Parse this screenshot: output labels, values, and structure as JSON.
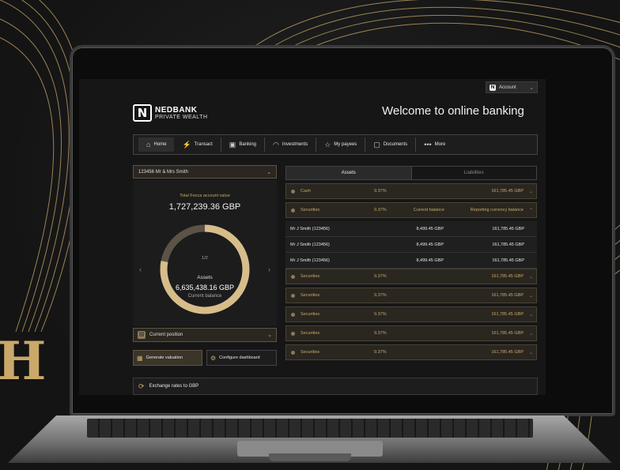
{
  "account_menu": {
    "label": "Account"
  },
  "brand": {
    "name_top": "NEDBANK",
    "name_bottom": "PRIVATE WEALTH"
  },
  "welcome": "Welcome to online banking",
  "nav": [
    {
      "label": "Home",
      "icon": "home-icon",
      "glyph": "⌂"
    },
    {
      "label": "Transact",
      "icon": "transact-icon",
      "glyph": "⚡"
    },
    {
      "label": "Banking",
      "icon": "briefcase-icon",
      "glyph": "▣"
    },
    {
      "label": "Investments",
      "icon": "gauge-icon",
      "glyph": "◠"
    },
    {
      "label": "My payees",
      "icon": "star-icon",
      "glyph": "☆"
    },
    {
      "label": "Documents",
      "icon": "documents-icon",
      "glyph": "▢"
    },
    {
      "label": "More",
      "icon": "more-icon",
      "glyph": "•••"
    }
  ],
  "account_select": {
    "value": "123456   Mr & Mrs Smith"
  },
  "summary": {
    "total_label": "Total Fecca account value",
    "total_value": "1,727,239.36 GBP",
    "page": "1/2",
    "ring_label": "Assets",
    "ring_value": "6,635,438.16 GBP",
    "ring_sublabel": "Current balance",
    "ring_fraction": 0.78
  },
  "current_position": "Current position",
  "buttons": {
    "generate": "Generate valuation",
    "configure": "Configure dashboard"
  },
  "tabs": [
    "Assets",
    "Liabilities"
  ],
  "rows": [
    {
      "kind": "cat",
      "name": "Cash",
      "pct": "9.37%",
      "mid": "",
      "val": "161,785.45 GBP",
      "chev": "⌄"
    },
    {
      "kind": "cat",
      "name": "Securities",
      "pct": "9.37%",
      "mid": "Current balance",
      "val": "Reporting currency balance",
      "chev": "⌃"
    },
    {
      "kind": "sub",
      "name": "Mr J Smith (123456)",
      "pct": "",
      "mid": "8,499.45 GBP",
      "val": "161,785.45 GBP",
      "chev": ""
    },
    {
      "kind": "sub",
      "name": "Mr J Smith (123456)",
      "pct": "",
      "mid": "8,499.45 GBP",
      "val": "161,785.45 GBP",
      "chev": ""
    },
    {
      "kind": "sub",
      "name": "Mr J Smith (123456)",
      "pct": "",
      "mid": "8,499.45 GBP",
      "val": "161,785.45 GBP",
      "chev": ""
    },
    {
      "kind": "cat",
      "name": "Securities",
      "pct": "9.37%",
      "mid": "",
      "val": "161,785.45 GBP",
      "chev": "⌄"
    },
    {
      "kind": "cat",
      "name": "Securities",
      "pct": "9.37%",
      "mid": "",
      "val": "161,785.45 GBP",
      "chev": "⌄"
    },
    {
      "kind": "cat",
      "name": "Securities",
      "pct": "9.37%",
      "mid": "",
      "val": "161,785.45 GBP",
      "chev": "⌄"
    },
    {
      "kind": "cat",
      "name": "Securities",
      "pct": "9.37%",
      "mid": "",
      "val": "161,785.45 GBP",
      "chev": "⌄"
    },
    {
      "kind": "cat",
      "name": "Securities",
      "pct": "9.37%",
      "mid": "",
      "val": "161,785.45 GBP",
      "chev": "⌄"
    }
  ],
  "exchange": "Exchange rates to GBP",
  "colors": {
    "gold": "#c9a86a",
    "background": "#141414"
  }
}
